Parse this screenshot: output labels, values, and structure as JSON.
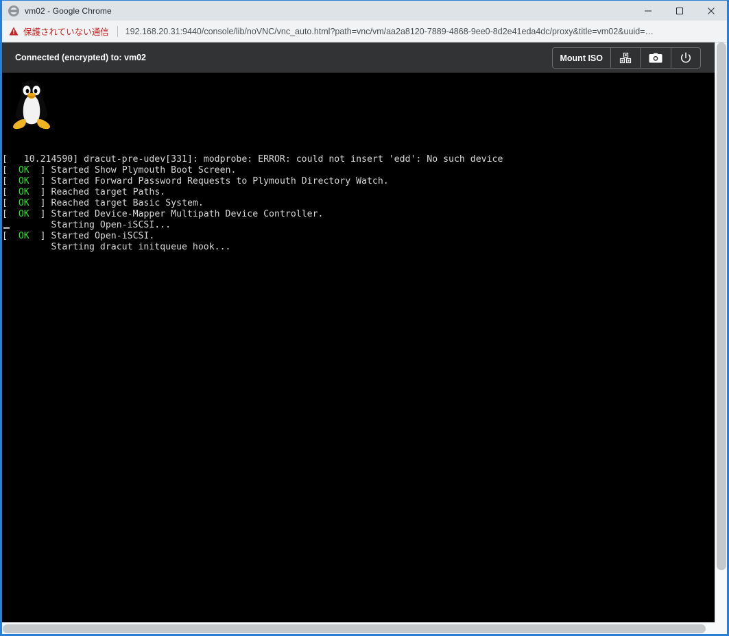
{
  "window": {
    "title": "vm02 - Google Chrome",
    "favicon": "globe-icon",
    "controls": {
      "minimize": "minimize-icon",
      "maximize": "maximize-icon",
      "close": "close-icon"
    }
  },
  "urlbar": {
    "security_icon": "warning-triangle-icon",
    "security_label": "保護されていない通信",
    "url": "192.168.20.31:9440/console/lib/noVNC/vnc_auto.html?path=vnc/vm/aa2a8120-7889-4868-9ee0-8d2e41eda4dc/proxy&title=vm02&uuid=…"
  },
  "vnc": {
    "status": "Connected (encrypted) to: vm02",
    "toolbar": {
      "mount_iso_label": "Mount ISO",
      "keyboard_icon": "keyboard-keys-icon",
      "screenshot_icon": "camera-icon",
      "power_icon": "power-icon"
    },
    "logo": "tux-linux-penguin-logo"
  },
  "console": {
    "lines": [
      {
        "prefix": "[",
        "status": "",
        "suffix": "]",
        "text": "   10.214590] dracut-pre-udev[331]: modprobe: ERROR: could not insert 'edd': No such device",
        "raw": true
      },
      {
        "status": "OK",
        "text": "Started Show Plymouth Boot Screen."
      },
      {
        "status": "OK",
        "text": "Started Forward Password Requests to Plymouth Directory Watch."
      },
      {
        "status": "OK",
        "text": "Reached target Paths."
      },
      {
        "status": "OK",
        "text": "Reached target Basic System."
      },
      {
        "status": "OK",
        "text": "Started Device-Mapper Multipath Device Controller."
      },
      {
        "status": null,
        "text": "Starting Open-iSCSI..."
      },
      {
        "status": "OK",
        "text": "Started Open-iSCSI."
      },
      {
        "status": null,
        "text": "Starting dracut initqueue hook..."
      }
    ],
    "cursor": "_"
  },
  "colors": {
    "window_border": "#2a7fd4",
    "titlebar_bg": "#dee3e8",
    "urlbar_bg": "#f1f3f4",
    "insecure_red": "#c5221f",
    "vnc_header_bg": "#313335",
    "console_bg": "#000000",
    "console_text": "#d8d8d8",
    "status_ok_green": "#2ee02e",
    "scrollbar_thumb": "#c5c9cc"
  }
}
